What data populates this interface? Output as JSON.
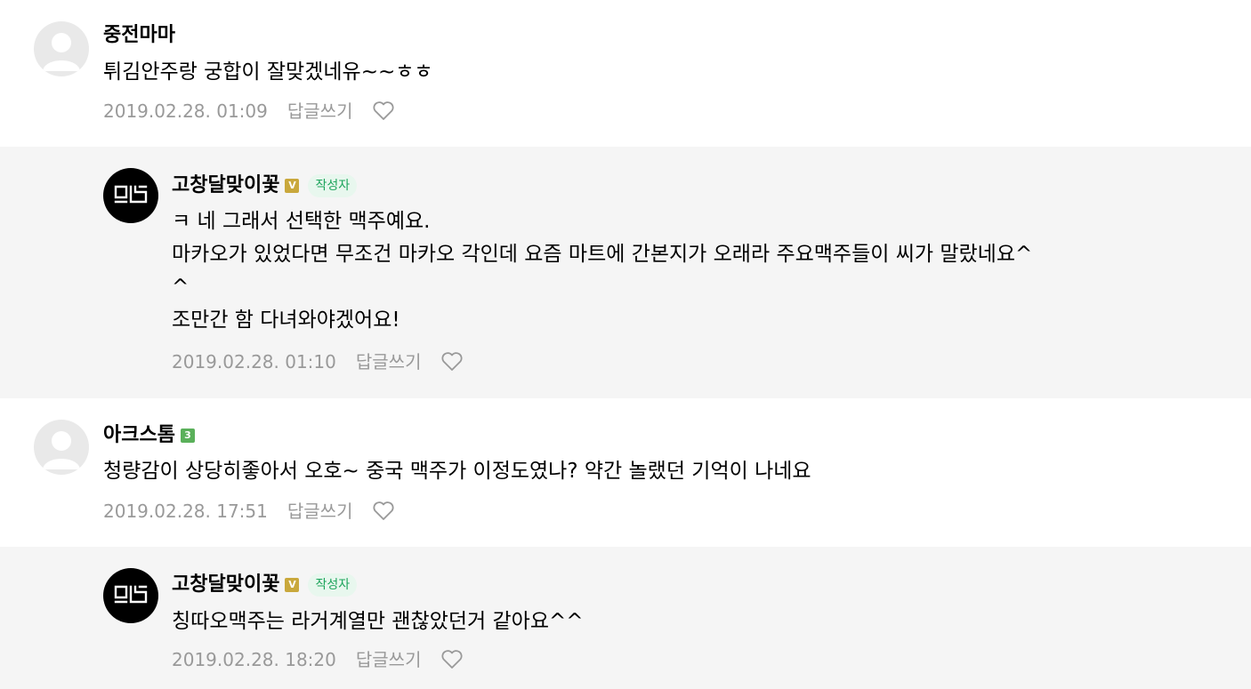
{
  "comments": [
    {
      "author": "중전마마",
      "text": [
        "튀김안주랑 궁합이 잘맞겠네유~~ㅎㅎ"
      ],
      "date": "2019.02.28. 01:09",
      "reply_label": "답글쓰기",
      "level_badge": ""
    },
    {
      "author": "고창달맞이꽃",
      "verified_badge": "V",
      "author_tag": "작성자",
      "text": [
        "ㅋ 네 그래서 선택한 맥주예요.",
        "마카오가 있었다면 무조건 마카오 각인데 요즘 마트에 간본지가 오래라 주요맥주들이 씨가 말랐네요^",
        "^",
        "조만간 함 다녀와야겠어요!"
      ],
      "date": "2019.02.28. 01:10",
      "reply_label": "답글쓰기"
    },
    {
      "author": "아크스톰",
      "level_badge": "3",
      "text": [
        "청량감이 상당히좋아서 오호~ 중국 맥주가 이정도였나? 약간 놀랬던 기억이 나네요"
      ],
      "date": "2019.02.28. 17:51",
      "reply_label": "답글쓰기"
    },
    {
      "author": "고창달맞이꽃",
      "verified_badge": "V",
      "author_tag": "작성자",
      "text": [
        "칭따오맥주는 라거계열만 괜찮았던거 같아요^^"
      ],
      "date": "2019.02.28. 18:20",
      "reply_label": "답글쓰기"
    }
  ],
  "icons": {
    "like": "heart-outline-icon",
    "avatar_default": "default-profile-icon",
    "avatar_brand": "brand-logo-icon"
  },
  "colors": {
    "reply_background": "#f5f5f5",
    "meta_text": "#999999",
    "author_tag_text": "#1ca45b",
    "author_tag_bg": "#e8f7ee",
    "verified_badge": "#c9a83c",
    "level_badge": "#5ab05a"
  }
}
